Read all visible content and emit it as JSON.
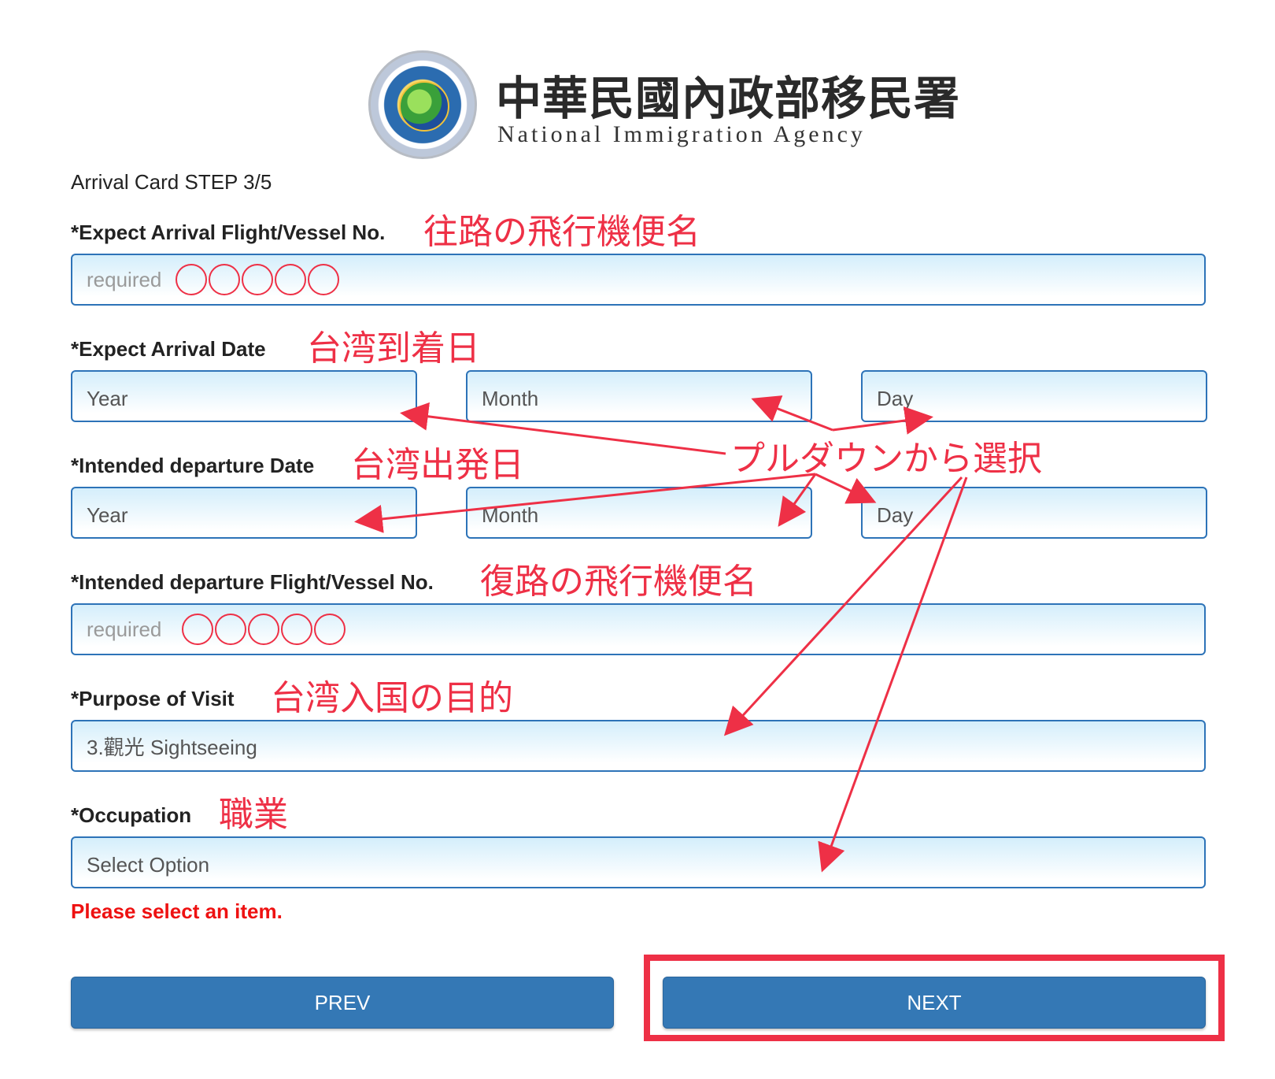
{
  "header": {
    "org_name_zh": "中華民國內政部移民署",
    "org_name_en": "National Immigration Agency"
  },
  "step": "Arrival Card STEP 3/5",
  "fields": {
    "arrival_flight": {
      "label": "*Expect Arrival Flight/Vessel No.",
      "placeholder": "required",
      "annotation": "往路の飛行機便名"
    },
    "arrival_date": {
      "label": "*Expect Arrival Date",
      "year": "Year",
      "month": "Month",
      "day": "Day",
      "annotation": "台湾到着日"
    },
    "departure_date": {
      "label": "*Intended departure Date",
      "year": "Year",
      "month": "Month",
      "day": "Day",
      "annotation": "台湾出発日"
    },
    "departure_flight": {
      "label": "*Intended departure Flight/Vessel No.",
      "placeholder": "required",
      "annotation": "復路の飛行機便名"
    },
    "purpose": {
      "label": "*Purpose of Visit",
      "value": "3.觀光 Sightseeing",
      "annotation": "台湾入国の目的"
    },
    "occupation": {
      "label": "*Occupation",
      "value": "Select Option",
      "annotation": "職業"
    }
  },
  "dropdown_annotation": "プルダウンから選択",
  "error_message": "Please select an item.",
  "buttons": {
    "prev": "PREV",
    "next": "NEXT"
  },
  "colors": {
    "field_border": "#2d73b8",
    "button": "#3478b5",
    "annotation": "#ee3046",
    "error": "#ee1111"
  }
}
